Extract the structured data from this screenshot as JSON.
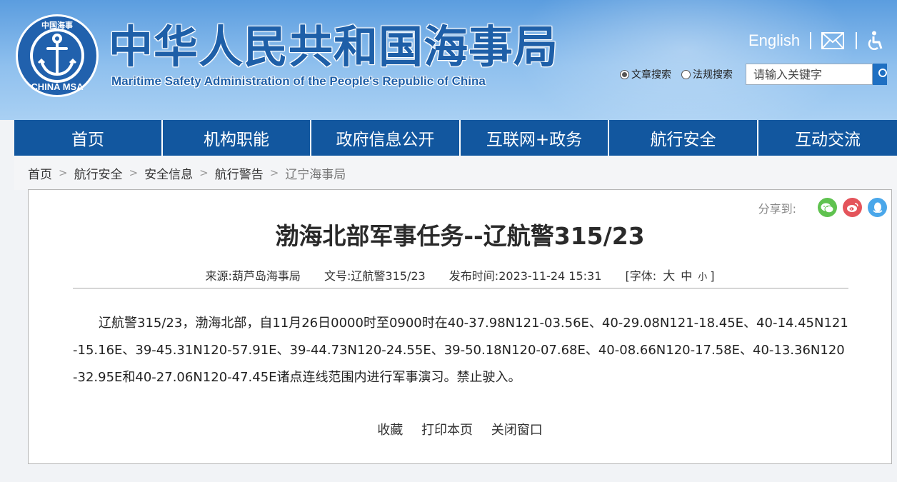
{
  "header": {
    "title": "中华人民共和国海事局",
    "subtitle": "Maritime Safety Administration of the People's Republic of China",
    "logo_text": "CHINA MSA",
    "logo_top_text": "中国海事",
    "english_link": "English",
    "mail_icon": "mail-icon",
    "accessibility_icon": "accessibility-icon"
  },
  "search": {
    "options": [
      {
        "label": "文章搜索",
        "selected": true
      },
      {
        "label": "法规搜索",
        "selected": false
      }
    ],
    "placeholder": "请输入关键字",
    "button_icon": "search-icon"
  },
  "nav": {
    "items": [
      "首页",
      "机构职能",
      "政府信息公开",
      "互联网+政务",
      "航行安全",
      "互动交流"
    ]
  },
  "breadcrumb": [
    "首页",
    "航行安全",
    "安全信息",
    "航行警告",
    "辽宁海事局"
  ],
  "share": {
    "label": "分享到:",
    "icons": [
      "wechat-icon",
      "weibo-icon",
      "qq-icon"
    ]
  },
  "article": {
    "title": "渤海北部军事任务--辽航警315/23",
    "meta": {
      "source_label": "来源:",
      "source": "葫芦岛海事局",
      "doc_no_label": "文号:",
      "doc_no": "辽航警315/23",
      "published_label": "发布时间:",
      "published": "2023-11-24 15:31",
      "font_label": "[字体:",
      "font_big": "大",
      "font_mid": "中",
      "font_small": "小",
      "font_close": "]"
    },
    "body": "辽航警315/23，渤海北部，自11月26日0000时至0900时在40-37.98N121-03.56E、40-29.08N121-18.45E、40-14.45N121-15.16E、39-45.31N120-57.91E、39-44.73N120-24.55E、39-50.18N120-07.68E、40-08.66N120-17.58E、40-13.36N120-32.95E和40-27.06N120-47.45E诸点连线范围内进行军事演习。禁止驶入。",
    "actions": {
      "favorite": "收藏",
      "print": "打印本页",
      "close": "关闭窗口"
    }
  },
  "colors": {
    "nav_bg": "#12579f",
    "title_blue": "#1e5fa8",
    "wechat": "#5fc24f",
    "weibo": "#e4545b",
    "qq": "#4aa7ea"
  }
}
